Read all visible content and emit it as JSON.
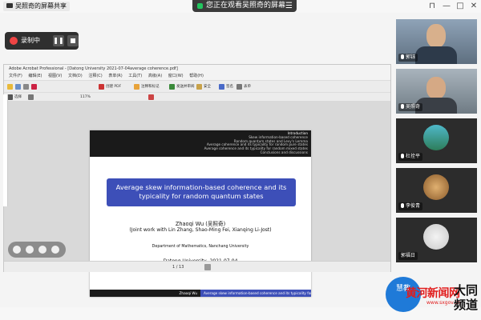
{
  "share_banner": {
    "text": "您正在观看吴照奇的屏幕",
    "menu_icon": "menu-icon"
  },
  "window_controls": {
    "pin": "⊓",
    "minimize": "—",
    "maximize": "□",
    "close": "✕"
  },
  "recording": {
    "label": "录制中",
    "pause_glyph": "❚❚"
  },
  "acrobat": {
    "title": "Adobe Acrobat Professional - [Datong University 2021-07-04average coherence.pdf]",
    "menus": [
      "文件(F)",
      "编辑(E)",
      "视图(V)",
      "文档(D)",
      "注释(C)",
      "表单(R)",
      "工具(T)",
      "高级(A)",
      "窗口(W)",
      "帮助(H)"
    ],
    "toolbar1": [
      "创建 PDF",
      "注释和标记",
      "发送并审阅",
      "安全",
      "签名",
      "表单"
    ],
    "toolbar2": [
      "选择",
      "117%"
    ],
    "status_page": "1 / 13"
  },
  "slide": {
    "nav_items": [
      "Introduction",
      "Skew information-based coherence",
      "Random quantum states and Levy's Lemma",
      "Average coherence and its typicality for random pure states",
      "Average coherence and its typicality for random mixed states",
      "Conclusions and discussions"
    ],
    "title": "Average skew information-based coherence and its typicality for random quantum states",
    "author": "Zhaoqi Wu (吴照奇)",
    "joint": "(Joint work with Lin Zhang, Shao-Ming Fei, Xianqing Li-Jost)",
    "department": "Department of Mathematics, Nanchang University",
    "venue_date": "Datong University, 2021-07-04",
    "footer_left": "Zhaoqi Wu",
    "footer_right": "Average skew information-based coherence and its typicality for rando"
  },
  "participants": [
    {
      "name": "郭钰",
      "kind": "video",
      "bg": "#6b7c8f"
    },
    {
      "name": "吴照奇",
      "kind": "video",
      "bg": "#7d8a95"
    },
    {
      "name": "杜拴平",
      "kind": "avatar",
      "bg": "#2f2f2f"
    },
    {
      "name": "李俊青",
      "kind": "avatar",
      "bg": "#2f2f2f"
    },
    {
      "name": "郭福日",
      "kind": "avatar",
      "bg": "#2f2f2f"
    }
  ],
  "bottom": {
    "label": "吴照奇的屏幕共享"
  },
  "watermark": {
    "bubble": "慧教",
    "main": "黄河新闻网",
    "url": "www.sxgov.cn",
    "right_top": "大同",
    "right_bottom": "频道"
  },
  "colors": {
    "slide_blue": "#3d4fb8",
    "accent_red": "#e11d1d",
    "rec_red": "#ef4444"
  }
}
